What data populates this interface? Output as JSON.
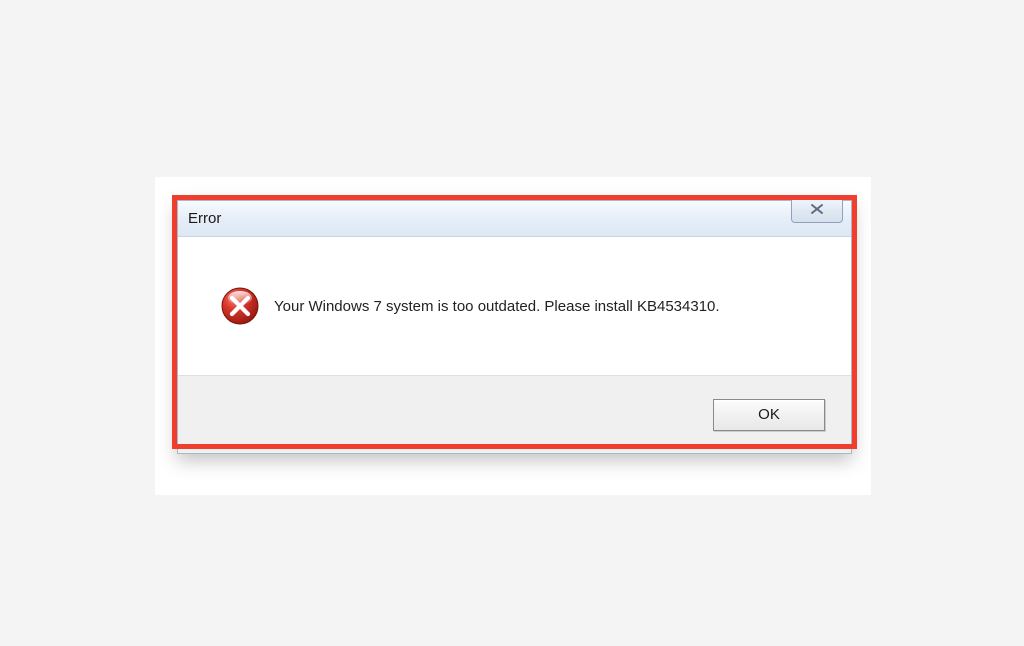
{
  "dialog": {
    "title": "Error",
    "message": "Your Windows 7 system is too outdated. Please install KB4534310.",
    "ok_label": "OK"
  },
  "colors": {
    "highlight_border": "#ef3e2e",
    "error_icon_red": "#cc2a1f"
  }
}
